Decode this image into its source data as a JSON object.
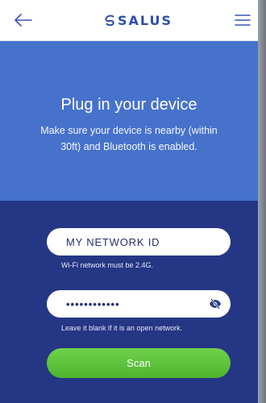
{
  "header": {
    "logo_text": "SALUS",
    "icons": {
      "back": "arrow-left-icon",
      "menu": "hamburger-menu-icon",
      "logo": "salus-swirl-icon"
    }
  },
  "hero": {
    "title": "Plug in your device",
    "subtitle": "Make sure your device is nearby (within 30ft) and Bluetooth is enabled."
  },
  "form": {
    "network_id": {
      "value": "",
      "placeholder": "MY NETWORK ID",
      "hint": "Wi-Fi network must be 2.4G."
    },
    "password": {
      "value": "••••••••••••",
      "hint": "Leave it blank if it is an open network.",
      "toggle_icon": "eye-slash-icon"
    },
    "scan_label": "Scan"
  },
  "colors": {
    "header_bg": "#ffffff",
    "hero_bg": "#4672cc",
    "form_bg": "#253685",
    "accent_blue": "#2e4fb0",
    "scan_green": "#5cc23a"
  }
}
